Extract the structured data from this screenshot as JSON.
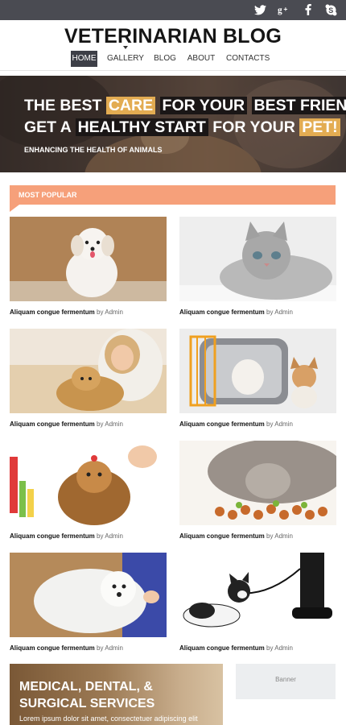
{
  "social": {
    "icons": [
      "twitter-icon",
      "google-plus-icon",
      "facebook-icon",
      "skype-icon"
    ],
    "bar_color": "#4a4b52"
  },
  "header": {
    "title": "VETERINARIAN BLOG"
  },
  "nav": {
    "items": [
      "HOME",
      "GALLERY",
      "BLOG",
      "ABOUT",
      "CONTACTS"
    ],
    "active": "HOME"
  },
  "hero": {
    "line1": {
      "p1": "THE BEST",
      "p2": "CARE",
      "p3": "FOR YOUR",
      "p4": "BEST FRIEND!"
    },
    "line2": {
      "p1": "GET A",
      "p2": "HEALTHY START",
      "p3": "FOR YOUR",
      "p4": "PET!"
    },
    "subtitle": "ENHANCING THE HEALTH OF ANIMALS",
    "accent": "#e3ac52"
  },
  "popular": {
    "label": "MOST POPULAR",
    "color": "#f6a07a"
  },
  "posts": [
    {
      "title": "Aliquam congue fermentum",
      "by": "by",
      "author": "Admin",
      "image": "white-puppy-photo"
    },
    {
      "title": "Aliquam congue fermentum",
      "by": "by",
      "author": "Admin",
      "image": "grey-kitten-photo"
    },
    {
      "title": "Aliquam congue fermentum",
      "by": "by",
      "author": "Admin",
      "image": "woman-with-golden-retriever-photo"
    },
    {
      "title": "Aliquam congue fermentum",
      "by": "by",
      "author": "Admin",
      "image": "cat-carrier-and-chihuahua-photo"
    },
    {
      "title": "Aliquam congue fermentum",
      "by": "by",
      "author": "Admin",
      "image": "yorkshire-terrier-grooming-photo"
    },
    {
      "title": "Aliquam congue fermentum",
      "by": "by",
      "author": "Admin",
      "image": "cat-eating-food-photo"
    },
    {
      "title": "Aliquam congue fermentum",
      "by": "by",
      "author": "Admin",
      "image": "white-terrier-grooming-photo"
    },
    {
      "title": "Aliquam congue fermentum",
      "by": "by",
      "author": "Admin",
      "image": "boston-terrier-on-leash-photo"
    }
  ],
  "promo": {
    "title": "MEDICAL, DENTAL, & SURGICAL SERVICES",
    "text": "Lorem ipsum dolor sit amet, consectetuer adipiscing elit"
  },
  "banner": {
    "label": "Banner"
  }
}
